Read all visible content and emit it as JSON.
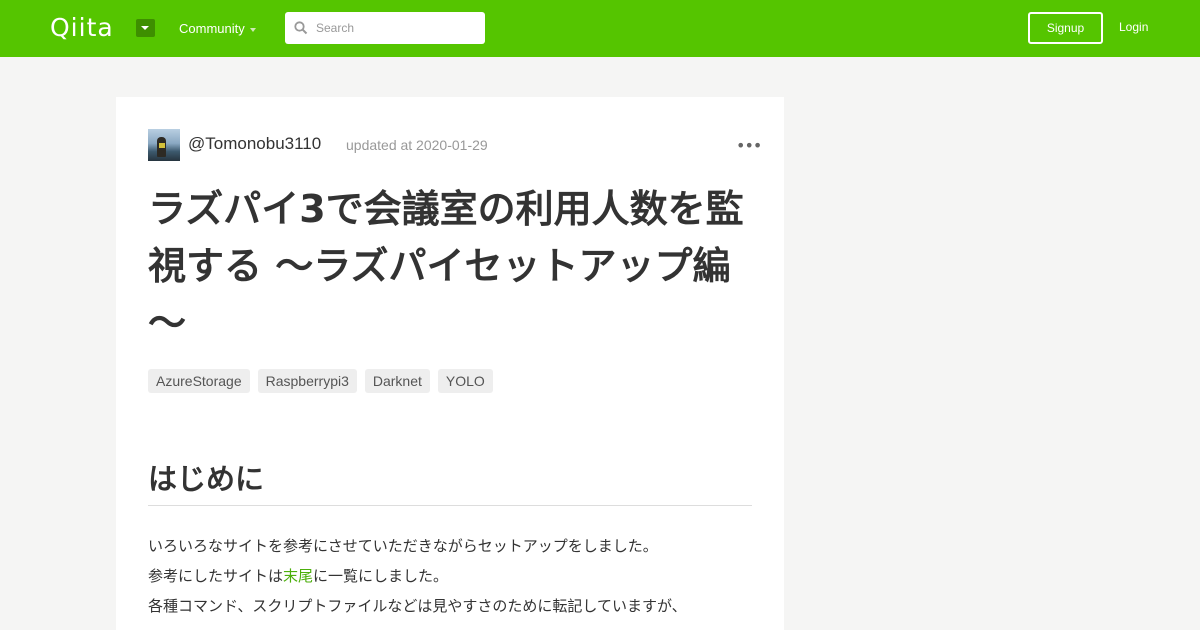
{
  "header": {
    "logo": "Qiita",
    "community_label": "Community",
    "search_placeholder": "Search",
    "signup_label": "Signup",
    "login_label": "Login"
  },
  "article": {
    "author": "@Tomonobu3110",
    "updated": "updated at 2020-01-29",
    "more_label": "•••",
    "title": "ラズパイ3で会議室の利用人数を監視する ～ラズパイセットアップ編～",
    "tags": [
      "AzureStorage",
      "Raspberrypi3",
      "Darknet",
      "YOLO"
    ],
    "section_heading": "はじめに",
    "paragraph": {
      "line1": "いろいろなサイトを参考にさせていただきながらセットアップをしました。",
      "line2_before": "参考にしたサイトは",
      "line2_link": "末尾",
      "line2_after": "に一覧にしました。",
      "line3": "各種コマンド、スクリプトファイルなどは見やすさのために転記していますが、"
    }
  },
  "colors": {
    "brand": "#55c500",
    "link": "#4caf0c",
    "background": "#f5f5f4"
  }
}
